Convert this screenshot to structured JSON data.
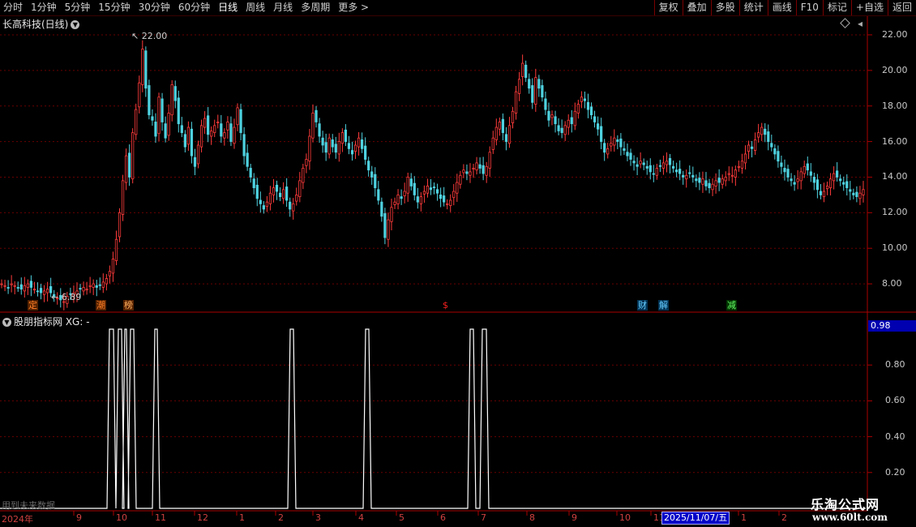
{
  "toolbar": {
    "periods": [
      "分时",
      "1分钟",
      "5分钟",
      "15分钟",
      "30分钟",
      "60分钟",
      "日线",
      "周线",
      "月线",
      "多周期",
      "更多 >"
    ],
    "active": "日线",
    "actions": [
      "复权",
      "叠加",
      "多股",
      "统计",
      "画线",
      "F10",
      "标记",
      "+自选",
      "返回"
    ]
  },
  "main": {
    "title": "长高科技(日线)",
    "high_label": "22.00",
    "low_label": "6.89",
    "price_axis": [
      "22.00",
      "20.00",
      "18.00",
      "16.00",
      "14.00",
      "12.00",
      "10.00",
      "8.00"
    ],
    "events": [
      {
        "label": "定",
        "color": "#ff7f27",
        "bg": "#552200"
      },
      {
        "label": "潮",
        "color": "#ff7f27",
        "bg": "#552200"
      },
      {
        "label": "榜",
        "color": "#ffb060",
        "bg": "#552200"
      },
      {
        "label": "$",
        "color": "#ff2020",
        "bg": "transparent"
      },
      {
        "label": "财",
        "color": "#66ccff",
        "bg": "#003355"
      },
      {
        "label": "解",
        "color": "#66ccff",
        "bg": "#003355"
      },
      {
        "label": "减",
        "color": "#66ff66",
        "bg": "#003300"
      }
    ]
  },
  "indicator": {
    "title": "股朋指标网 XG: -",
    "current_value": "0.98",
    "axis": [
      "0.80",
      "0.60",
      "0.40",
      "0.20"
    ],
    "note": "用到未来数据"
  },
  "time_axis": {
    "labels": [
      "2024年",
      "9",
      "10",
      "11",
      "12",
      "1",
      "2",
      "3",
      "4",
      "5",
      "6",
      "7",
      "8",
      "9",
      "10",
      "11",
      "1",
      "2"
    ],
    "cursor_date": "2025/11/07/五"
  },
  "watermark": {
    "title": "乐淘公式网",
    "url": "www.60lt.com"
  },
  "colors": {
    "up": "#ff3b3b",
    "down": "#4fd2e0",
    "grid": "#7a0000",
    "signal": "#ffffff"
  },
  "chart_data": {
    "type": "candlestick",
    "ylim": [
      6.5,
      22.5
    ],
    "closes": [
      8.0,
      7.9,
      7.8,
      8.0,
      7.9,
      7.8,
      7.7,
      7.9,
      8.0,
      7.8,
      7.7,
      7.6,
      7.5,
      7.6,
      7.7,
      7.5,
      7.3,
      7.2,
      7.1,
      7.0,
      7.3,
      7.4,
      7.5,
      7.6,
      7.7,
      7.8,
      7.7,
      7.9,
      8.0,
      7.8,
      7.9,
      8.1,
      8.3,
      8.7,
      9.4,
      10.5,
      12.0,
      13.8,
      15.2,
      14.0,
      16.5,
      17.8,
      19.3,
      21.2,
      19.0,
      17.5,
      17.2,
      16.3,
      18.5,
      17.1,
      16.2,
      17.6,
      19.2,
      18.3,
      17.0,
      16.5,
      15.7,
      16.8,
      15.2,
      14.6,
      15.8,
      16.9,
      17.3,
      16.4,
      16.6,
      16.9,
      17.1,
      16.3,
      16.5,
      17.1,
      16.0,
      16.8,
      17.9,
      16.5,
      15.2,
      14.6,
      14.0,
      13.4,
      12.8,
      12.5,
      12.2,
      12.6,
      13.1,
      13.4,
      13.2,
      12.9,
      13.3,
      12.7,
      12.2,
      12.5,
      13.0,
      13.8,
      14.5,
      15.0,
      16.3,
      17.6,
      17.1,
      16.3,
      15.8,
      15.4,
      16.2,
      15.7,
      15.4,
      16.0,
      16.5,
      16.0,
      15.6,
      15.3,
      15.8,
      16.2,
      15.6,
      15.0,
      14.4,
      14.0,
      13.4,
      12.7,
      11.8,
      10.6,
      11.6,
      12.3,
      12.6,
      13.0,
      12.8,
      13.2,
      14.0,
      13.5,
      13.0,
      12.6,
      12.9,
      13.2,
      13.5,
      13.3,
      13.4,
      13.1,
      12.8,
      12.6,
      12.5,
      12.7,
      13.2,
      13.7,
      14.1,
      14.4,
      14.2,
      14.3,
      14.5,
      14.8,
      14.5,
      14.2,
      14.6,
      15.4,
      16.2,
      16.8,
      17.1,
      16.5,
      16.0,
      16.9,
      17.7,
      18.8,
      19.5,
      20.4,
      19.6,
      19.0,
      18.2,
      19.6,
      19.0,
      18.5,
      17.8,
      17.2,
      17.5,
      17.0,
      16.6,
      16.5,
      16.9,
      17.2,
      17.0,
      17.7,
      18.1,
      18.5,
      18.3,
      17.8,
      17.5,
      17.1,
      16.7,
      16.0,
      15.4,
      15.6,
      15.9,
      16.2,
      16.0,
      15.7,
      15.5,
      15.2,
      15.0,
      14.8,
      14.6,
      14.9,
      14.7,
      14.5,
      14.3,
      14.2,
      14.5,
      14.6,
      14.8,
      14.9,
      14.7,
      14.5,
      14.3,
      14.2,
      14.0,
      14.1,
      14.2,
      14.0,
      13.8,
      13.7,
      13.9,
      13.5,
      13.4,
      13.6,
      13.8,
      13.7,
      13.9,
      14.0,
      14.2,
      14.1,
      14.4,
      14.6,
      14.9,
      15.3,
      15.8,
      15.6,
      16.1,
      16.5,
      16.8,
      16.4,
      16.0,
      15.7,
      15.3,
      14.9,
      14.6,
      14.3,
      14.0,
      13.8,
      13.6,
      13.9,
      14.3,
      14.6,
      14.4,
      14.1,
      13.7,
      13.3,
      13.0,
      13.2,
      13.5,
      13.9,
      14.2,
      14.0,
      13.8,
      13.6,
      13.4,
      13.2,
      13.0,
      12.9,
      13.1,
      13.3
    ],
    "signal_bars": [
      135,
      140,
      146,
      150,
      154,
      156,
      161,
      165,
      191,
      194,
      358,
      362,
      451,
      455,
      580,
      584,
      595,
      600
    ],
    "signal_ylim": [
      0,
      1
    ]
  }
}
